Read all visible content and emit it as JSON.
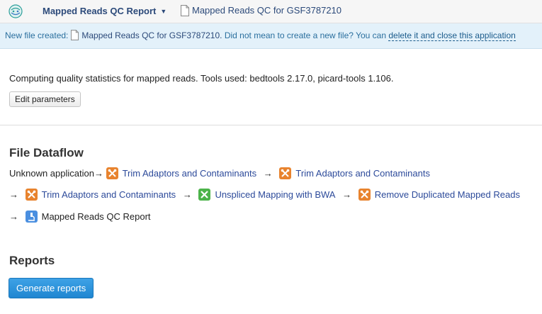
{
  "header": {
    "app_title": "Mapped Reads QC Report",
    "file_name": "Mapped Reads QC for GSF3787210"
  },
  "notice": {
    "prefix": "New file created:",
    "file_name": "Mapped Reads QC for GSF3787210.",
    "message": "Did not mean to create a new file? You can",
    "link": "delete it and close this application"
  },
  "main": {
    "description": "Computing quality statistics for mapped reads. Tools used: bedtools 2.17.0, picard-tools 1.106.",
    "edit_button": "Edit parameters"
  },
  "dataflow": {
    "heading": "File Dataflow",
    "arrow": "→",
    "start_label": "Unknown application",
    "nodes": [
      {
        "label": "Trim Adaptors and Contaminants",
        "icon": "trim-icon",
        "color": "#e8832e"
      },
      {
        "label": "Trim Adaptors and Contaminants",
        "icon": "trim-icon",
        "color": "#e8832e"
      },
      {
        "label": "Trim Adaptors and Contaminants",
        "icon": "trim-icon",
        "color": "#e8832e"
      },
      {
        "label": "Unspliced Mapping with BWA",
        "icon": "mapping-icon",
        "color": "#4cb34a"
      },
      {
        "label": "Remove Duplicated Mapped Reads",
        "icon": "trim-icon",
        "color": "#e8832e"
      },
      {
        "label": "Mapped Reads QC Report",
        "icon": "microscope-icon",
        "color": "#4a8fe0"
      }
    ]
  },
  "reports": {
    "heading": "Reports",
    "generate_button": "Generate reports"
  },
  "colors": {
    "accent": "#2c4a7a",
    "notice_bg": "#e3f1fa",
    "primary_button": "#2a90da"
  }
}
